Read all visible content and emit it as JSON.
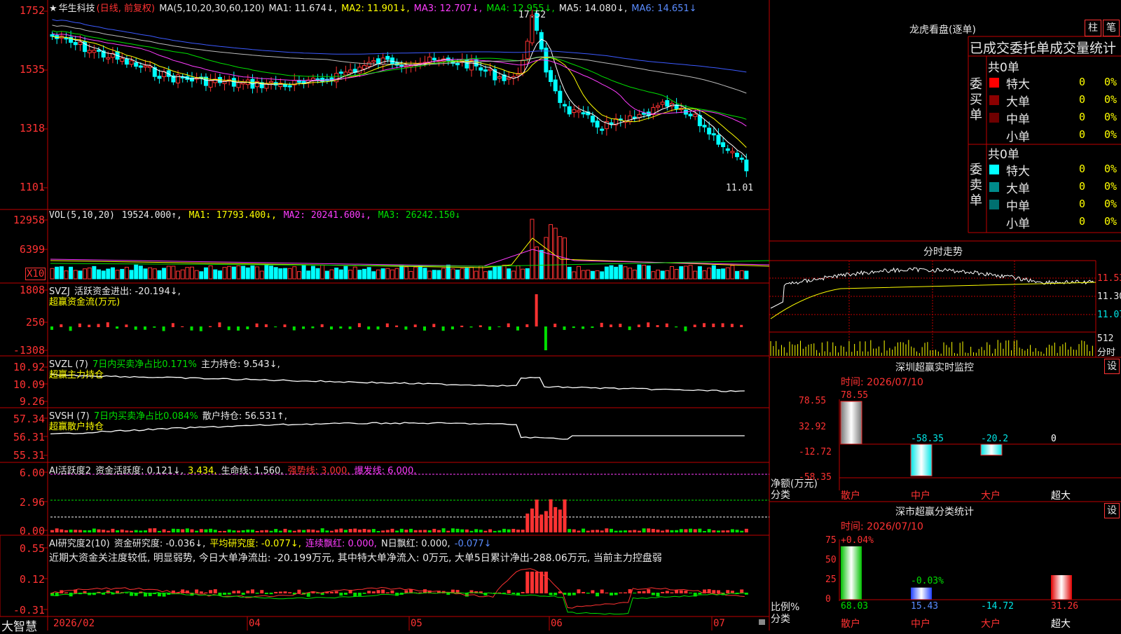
{
  "main": {
    "header": {
      "star": "★",
      "stock_name": "华生科技",
      "period": "(日线, 前复权)",
      "ma_spec": "MA(5,10,20,30,60,120)",
      "ma1": "MA1: 11.674↓,",
      "ma2": "MA2: 11.901↓,",
      "ma3": "MA3: 12.707↓,",
      "ma4": "MA4: 12.955↓,",
      "ma5": "MA5: 14.080↓,",
      "ma6": "MA6: 14.651↓"
    },
    "price_axis": [
      "1752",
      "1535",
      "1318",
      "1101"
    ],
    "high_label": "17.52",
    "low_label": "11.01"
  },
  "vol": {
    "header": {
      "name": "VOL(5,10,20)",
      "val": "19524.000↑,",
      "ma1": "MA1: 17793.400↓,",
      "ma2": "MA2: 20241.600↓,",
      "ma3": "MA3: 26242.150↓"
    },
    "axis": [
      "12958",
      "6399"
    ],
    "unit": "X10"
  },
  "svzj": {
    "header": {
      "name": "SVZJ",
      "label": "活跃资金进出: -20.194↓,",
      "subtitle": "超赢资金流(万元)"
    },
    "axis": [
      "1808",
      "250",
      "-1308"
    ]
  },
  "svzl": {
    "header": {
      "name": "SVZL (7)",
      "ratio": "7日内买卖净占比0.171%",
      "hold": "主力持仓: 9.543↓,",
      "subtitle": "超赢主力持仓"
    },
    "axis": [
      "10.92",
      "10.09",
      "9.26"
    ]
  },
  "svsh": {
    "header": {
      "name": "SVSH (7)",
      "ratio": "7日内买卖净占比0.084%",
      "hold": "散户持仓: 56.531↑,",
      "subtitle": "超赢散户持仓"
    },
    "axis": [
      "57.34",
      "56.31",
      "55.31"
    ]
  },
  "ai1": {
    "header": {
      "name": "AI活跃度2",
      "a": "资金活跃度: 0.121↓,",
      "b": "3.434,",
      "c": "生命线: 1.560,",
      "d": "强势线: 3.000,",
      "e": "爆发线: 6.000,"
    },
    "axis": [
      "6.00",
      "2.96",
      "0.00"
    ]
  },
  "ai2": {
    "header": {
      "name": "AI研究度2(10)",
      "a": "资金研究度: -0.036↓,",
      "b": "平均研究度: -0.077↓,",
      "c": "连续飘红: 0.000,",
      "d": "N日飘红: 0.000,",
      "e": "-0.077↓"
    },
    "comment": "近期大资金关注度较低, 明显弱势, 今日大单净流出: -20.199万元, 其中特大单净流入: 0万元, 大单5日累计净出-288.06万元, 当前主力控盘弱",
    "axis": [
      "0.55",
      "0.12",
      "-0.31"
    ]
  },
  "footer": {
    "brand": "大智慧",
    "months": [
      "2026/02",
      "04",
      "05",
      "06",
      "07"
    ]
  },
  "right": {
    "dragon": {
      "title": "龙虎看盘(逐单)",
      "btn_bar": "柱",
      "btn_count": "笔",
      "subtitle": "已成交委托单成交量统计",
      "buy": {
        "label": "委买单",
        "total": "共0单",
        "rows": [
          {
            "name": "特大",
            "count": "0",
            "pct": "0%",
            "color": "#ff0000"
          },
          {
            "name": "大单",
            "count": "0",
            "pct": "0%",
            "color": "#8b0000"
          },
          {
            "name": "中单",
            "count": "0",
            "pct": "0%",
            "color": "#6e0000"
          },
          {
            "name": "小单",
            "count": "0",
            "pct": "0%",
            "color": ""
          }
        ]
      },
      "sell": {
        "label": "委卖单",
        "total": "共0单",
        "rows": [
          {
            "name": "特大",
            "count": "0",
            "pct": "0%",
            "color": "#00ffff"
          },
          {
            "name": "大单",
            "count": "0",
            "pct": "0%",
            "color": "#008b8b"
          },
          {
            "name": "中单",
            "count": "0",
            "pct": "0%",
            "color": "#007070"
          },
          {
            "name": "小单",
            "count": "0",
            "pct": "0%",
            "color": ""
          }
        ]
      }
    },
    "intraday": {
      "title": "分时走势",
      "prices": [
        "11.53",
        "11.30",
        "11.07"
      ],
      "vol": "512",
      "vol_unit": "分时"
    },
    "sz_monitor": {
      "title": "深圳超赢实时监控",
      "set_btn": "设",
      "time": "时间: 2026/07/10",
      "axis": [
        "78.55",
        "32.92",
        "-12.72",
        "-58.35"
      ],
      "unit_label": "净额(万元)",
      "class_label": "分类",
      "bars": [
        {
          "cat": "散户",
          "value": 78.55,
          "label": "78.55"
        },
        {
          "cat": "中户",
          "value": -58.35,
          "label": "-58.35"
        },
        {
          "cat": "大户",
          "value": -20.2,
          "label": "-20.2"
        },
        {
          "cat": "超大",
          "value": 0,
          "label": "0"
        }
      ]
    },
    "sz_stats": {
      "title": "深市超赢分类统计",
      "set_btn": "设",
      "time": "时间: 2026/07/10",
      "axis": [
        "75",
        "50",
        "25",
        "0"
      ],
      "unit_label": "比例%",
      "class_label": "分类",
      "top_labels": [
        "+0.04%",
        "-0.03%"
      ],
      "bars": [
        {
          "cat": "散户",
          "value": 68.03,
          "label": "68.03"
        },
        {
          "cat": "中户",
          "value": 15.43,
          "label": "15.43"
        },
        {
          "cat": "大户",
          "value": -14.72,
          "label": "-14.72"
        },
        {
          "cat": "超大",
          "value": 31.26,
          "label": "31.26"
        }
      ]
    }
  }
}
